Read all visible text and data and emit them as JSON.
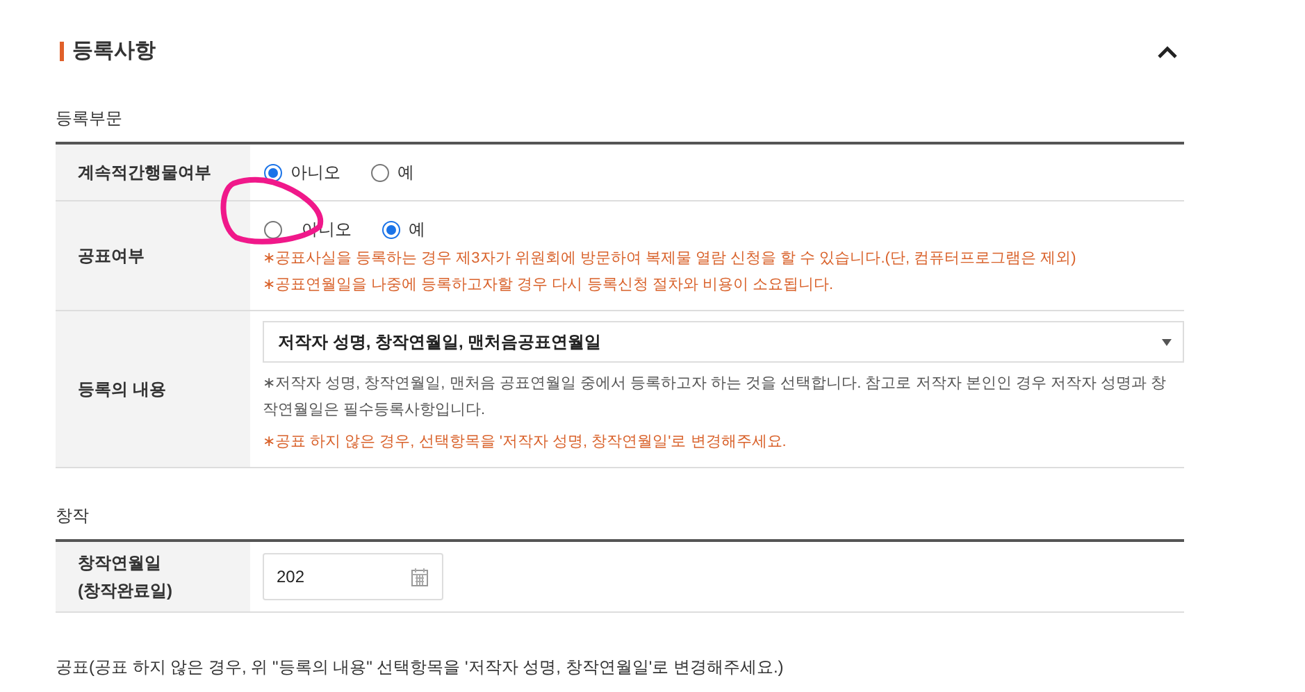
{
  "section": {
    "title": "등록사항",
    "expanded": true
  },
  "groups": [
    {
      "title": "등록부문",
      "rows": [
        {
          "kind": "radio",
          "label": "계속적간행물여부",
          "options": [
            {
              "label": "아니오",
              "selected": true
            },
            {
              "label": "예",
              "selected": false
            }
          ],
          "notes": []
        },
        {
          "kind": "radio",
          "label": "공표여부",
          "options": [
            {
              "label": "아니오",
              "selected": false
            },
            {
              "label": "예",
              "selected": true
            }
          ],
          "notes": [
            {
              "text": "∗공표사실을 등록하는 경우 제3자가 위원회에 방문하여 복제물 열람 신청을 할 수 있습니다.(단, 컴퓨터프로그램은 제외)",
              "warning": true
            },
            {
              "text": "∗공표연월일을 나중에 등록하고자할 경우 다시 등록신청 절차와 비용이 소요됩니다.",
              "warning": true
            }
          ]
        },
        {
          "kind": "select",
          "label": "등록의 내용",
          "value": "저작자 성명, 창작연월일, 맨처음공표연월일",
          "notes": [
            {
              "text": "∗저작자 성명, 창작연월일, 맨처음 공표연월일 중에서 등록하고자 하는 것을 선택합니다. 참고로 저작자 본인인 경우 저작자 성명과 창작연월일은 필수등록사항입니다.",
              "warning": false
            },
            {
              "text": "∗공표 하지 않은 경우, 선택항목을 '저작자 성명, 창작연월일'로 변경해주세요.",
              "warning": true
            }
          ]
        }
      ]
    },
    {
      "title": "창작",
      "rows": [
        {
          "kind": "date",
          "label": "창작연월일\n(창작완료일)",
          "value": "202",
          "notes": []
        }
      ]
    }
  ],
  "footer_note": "공표(공표 하지 않은 경우, 위 \"등록의 내용\" 선택항목을 '저작자 성명, 창작연월일'로 변경해주세요.)"
}
